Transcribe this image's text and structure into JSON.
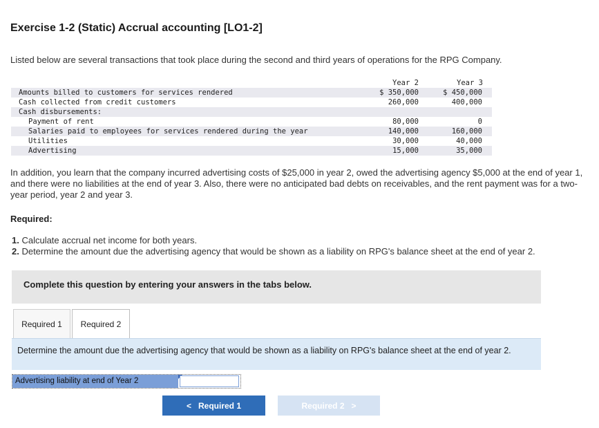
{
  "title": "Exercise 1-2 (Static) Accrual accounting [LO1-2]",
  "intro": "Listed below are several transactions that took place during the second and third years of operations for the RPG Company.",
  "table": {
    "header_year2": "Year 2",
    "header_year3": "Year 3",
    "rows": [
      {
        "label": "Amounts billed to customers for services rendered",
        "y2": "$ 350,000",
        "y3": "$ 450,000"
      },
      {
        "label": "Cash collected from credit customers",
        "y2": "260,000",
        "y3": "400,000"
      },
      {
        "label": "Cash disbursements:",
        "y2": "",
        "y3": ""
      },
      {
        "label": "Payment of rent",
        "y2": "80,000",
        "y3": "0"
      },
      {
        "label": "Salaries paid to employees for services rendered during the year",
        "y2": "140,000",
        "y3": "160,000"
      },
      {
        "label": "Utilities",
        "y2": "30,000",
        "y3": "40,000"
      },
      {
        "label": "Advertising",
        "y2": "15,000",
        "y3": "35,000"
      }
    ]
  },
  "paragraph": "In addition, you learn that the company incurred advertising costs of $25,000 in year 2, owed the advertising agency $5,000 at the end of year 1, and there were no liabilities at the end of year 3. Also, there were no anticipated bad debts on receivables, and the rent payment was for a two-year period, year 2 and year 3.",
  "required_heading": "Required:",
  "requirements": [
    {
      "num": "1.",
      "text": " Calculate accrual net income for both years."
    },
    {
      "num": "2.",
      "text": " Determine the amount due the advertising agency that would be shown as a liability on RPG's balance sheet at the end of year 2."
    }
  ],
  "banner": "Complete this question by entering your answers in the tabs below.",
  "tabs": [
    {
      "label": "Required 1"
    },
    {
      "label": "Required 2"
    }
  ],
  "panel_text": "Determine the amount due the advertising agency that would be shown as a liability on RPG's balance sheet at the end of year 2.",
  "answer": {
    "label": "Advertising liability at end of Year 2",
    "value": ""
  },
  "nav": {
    "prev_label": "Required 1",
    "next_label": "Required 2"
  },
  "colors": {
    "primary_button": "#2f6db8",
    "disabled_button": "#d6e3f3",
    "panel_bg": "#dceaf7",
    "answer_label_bg": "#7b9fd8"
  }
}
